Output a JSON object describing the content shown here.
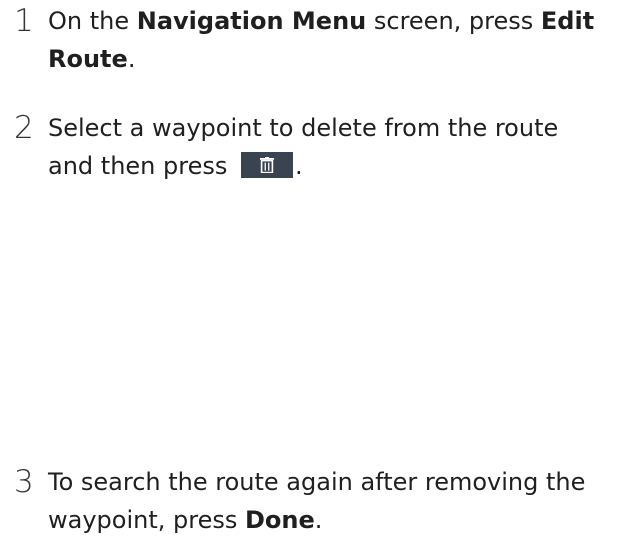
{
  "steps": [
    {
      "number": "1",
      "parts": {
        "t1": "On the ",
        "b1": "Navigation Menu",
        "t2": " screen, press ",
        "b2": "Edit Route",
        "t3": "."
      }
    },
    {
      "number": "2",
      "parts": {
        "t1": "Select a waypoint to delete from the route and then press ",
        "icon": "trash-icon",
        "t2": "."
      }
    },
    {
      "number": "3",
      "parts": {
        "t1": "To search the route again after removing the waypoint, press ",
        "b1": "Done",
        "t2": "."
      }
    }
  ],
  "colors": {
    "icon_button_bg": "#3a4350",
    "icon_fg": "#ffffff",
    "text": "#1f1f1f"
  }
}
